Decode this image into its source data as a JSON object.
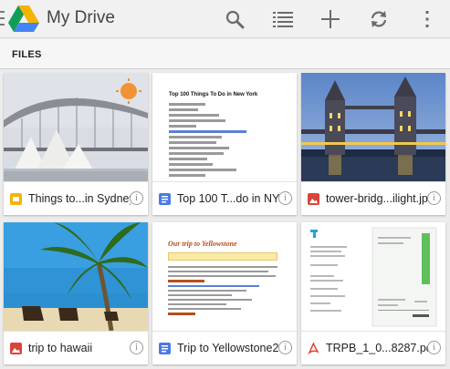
{
  "appbar": {
    "title": "My Drive",
    "actions": [
      "search-icon",
      "list-view-icon",
      "add-icon",
      "refresh-icon",
      "overflow-menu-icon"
    ]
  },
  "section": {
    "label": "FILES"
  },
  "files": [
    {
      "name": "Things to...in Sydney",
      "type": "slides",
      "icon": "presentation-icon",
      "icon_color": "#f4b400"
    },
    {
      "name": "Top 100 T...do in NYC",
      "type": "document",
      "icon": "document-icon",
      "icon_color": "#4a7ae8",
      "preview_title": "Top 100 Things To Do in New York"
    },
    {
      "name": "tower-bridg...ilight.jpg",
      "type": "image",
      "icon": "image-icon",
      "icon_color": "#d9453a"
    },
    {
      "name": "trip to hawaii",
      "type": "image",
      "icon": "image-icon",
      "icon_color": "#d9453a"
    },
    {
      "name": "Trip to Yellowstone2",
      "type": "document",
      "icon": "document-icon",
      "icon_color": "#4a7ae8",
      "preview_title": "Our trip to Yellowstone"
    },
    {
      "name": "TRPB_1_0...8287.pdf",
      "type": "pdf",
      "icon": "pdf-icon",
      "icon_color": "#e0442f"
    }
  ],
  "info_glyph": "i"
}
